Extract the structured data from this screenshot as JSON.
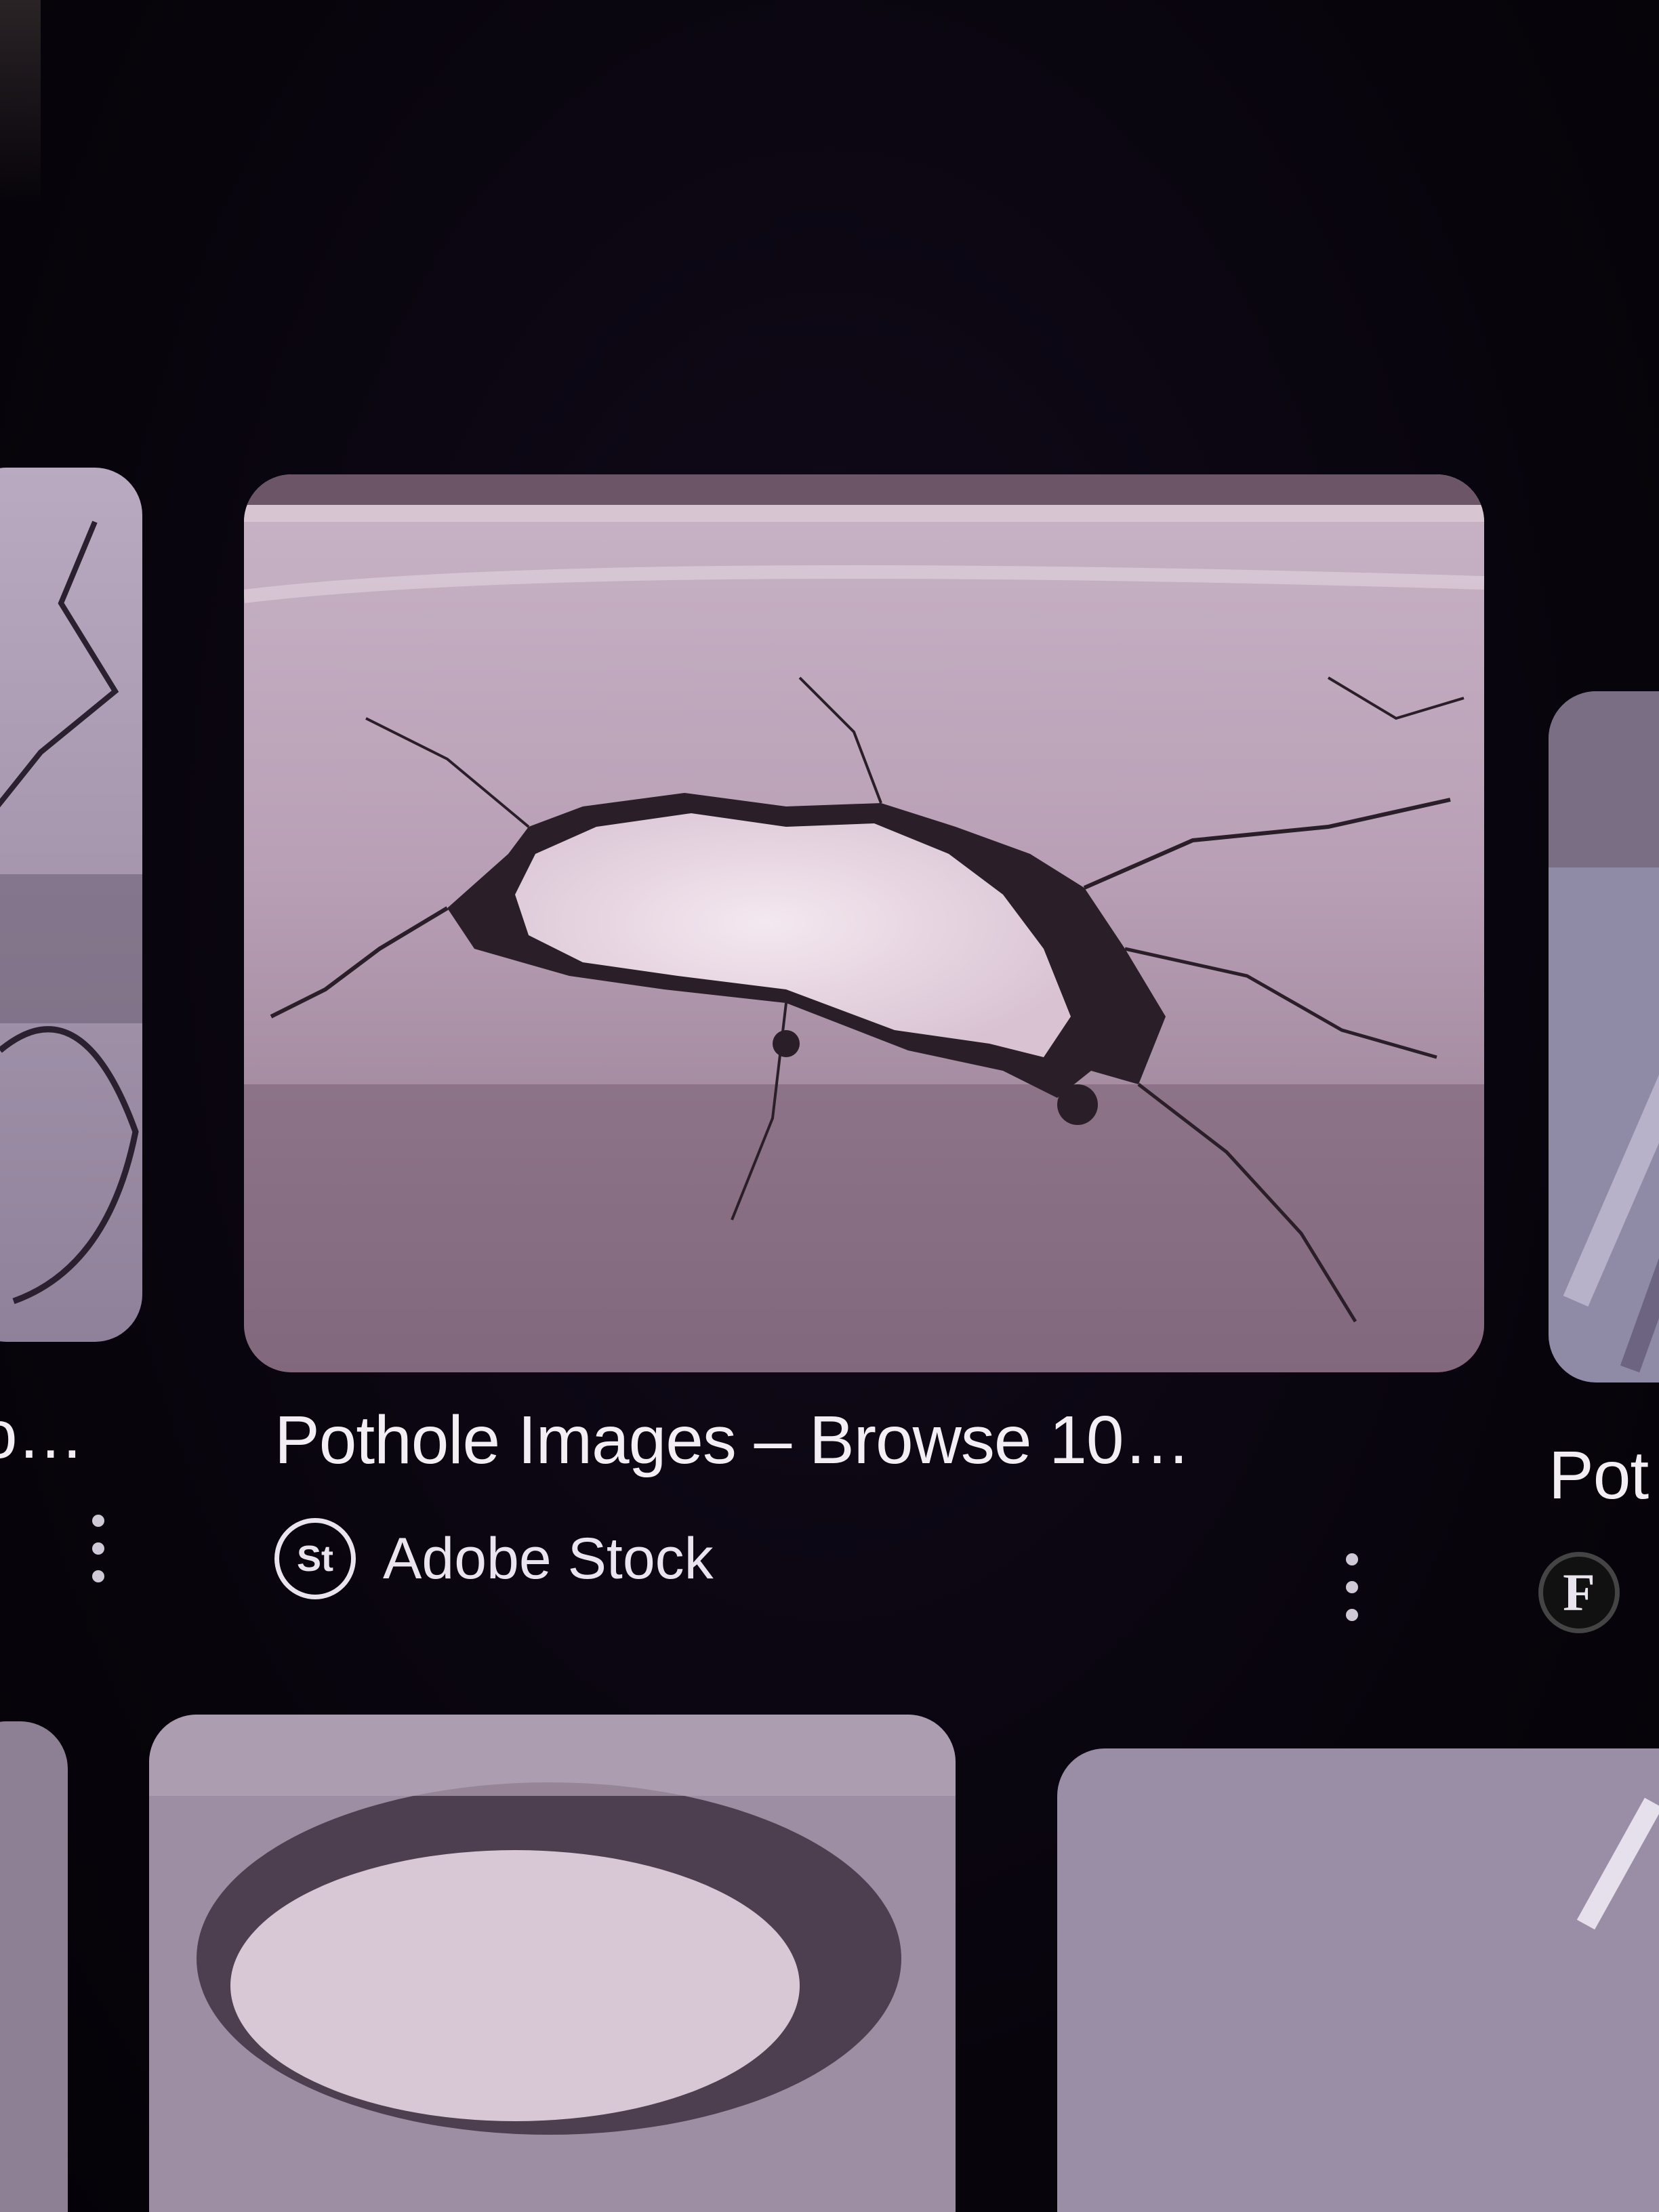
{
  "results": {
    "left_card": {
      "title": "o…"
    },
    "center_card": {
      "title": "Pothole Images – Browse 10…",
      "source_icon": "St",
      "source_name": "Adobe Stock"
    },
    "right_card": {
      "title": "Pot",
      "source_icon": "F"
    }
  },
  "colors": {
    "background": "#07040b",
    "text": "#f2eef4"
  },
  "icons": {
    "more": "more-vert-icon"
  }
}
